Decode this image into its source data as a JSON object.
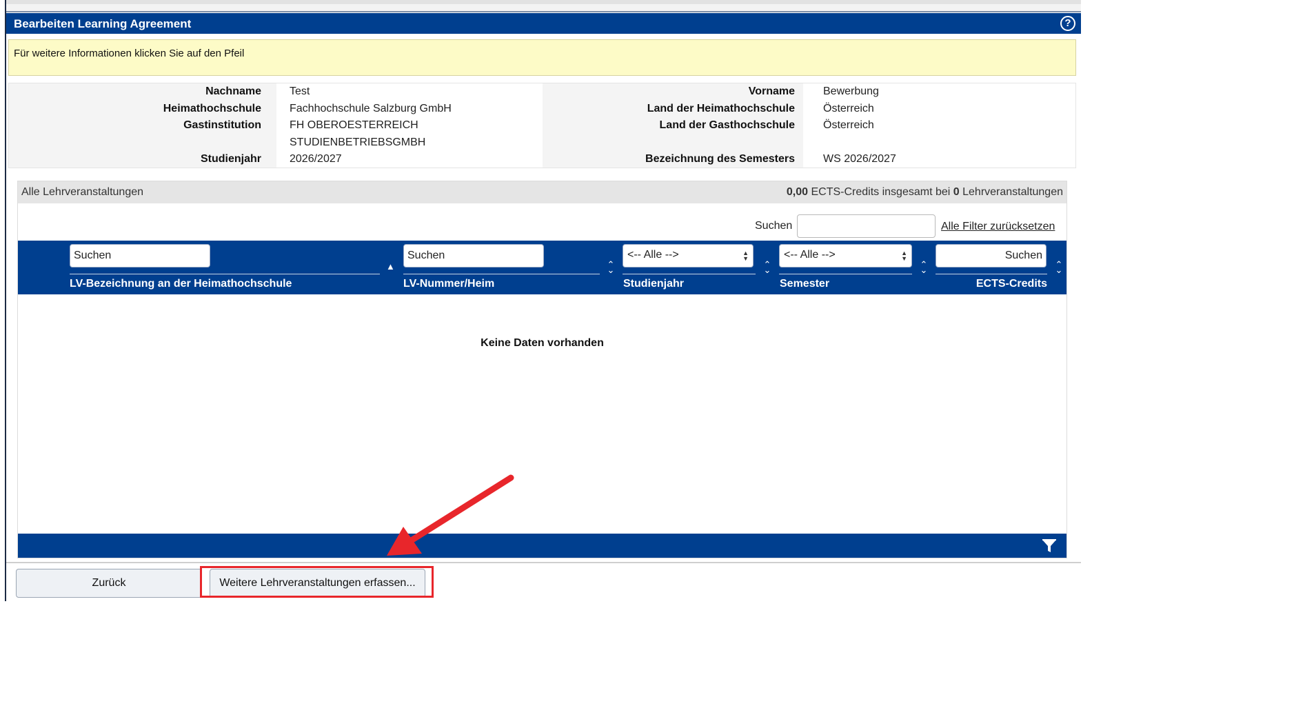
{
  "window": {
    "title": "Bearbeiten Learning Agreement",
    "help_icon": "question-circle-icon"
  },
  "info_box": {
    "text": "Für weitere Informationen klicken Sie auf den Pfeil"
  },
  "student_info": {
    "nachname_label": "Nachname",
    "nachname": "Test",
    "heimathochschule_label": "Heimathochschule",
    "heimathochschule": "Fachhochschule Salzburg GmbH",
    "gastinstitution_label": "Gastinstitution",
    "gastinstitution_line1": "FH OBEROESTERREICH",
    "gastinstitution_line2": "STUDIENBETRIEBSGMBH",
    "studienjahr_label": "Studienjahr",
    "studienjahr": "2026/2027",
    "vorname_label": "Vorname",
    "vorname": "Bewerbung",
    "land_heimat_label": "Land der Heimathochschule",
    "land_heimat": "Österreich",
    "land_gast_label": "Land der Gasthochschule",
    "land_gast": "Österreich",
    "semester_label": "Bezeichnung des Semesters",
    "semester": "WS 2026/2027"
  },
  "courses": {
    "heading": "Alle Lehrveranstaltungen",
    "ects_total": "0,00",
    "summary_mid": " ECTS-Credits insgesamt bei ",
    "course_count": "0",
    "summary_end": " Lehrveranstaltungen",
    "global_search_label": "Suchen",
    "global_search_value": "",
    "reset_filters": "Alle Filter zurücksetzen",
    "columns": [
      {
        "label": "LV-Bezeichnung an der Heimathochschule",
        "filter_placeholder": "Suchen"
      },
      {
        "label": "LV-Nummer/Heim",
        "filter_placeholder": "Suchen"
      },
      {
        "label": "Studienjahr",
        "filter_value": "<-- Alle -->"
      },
      {
        "label": "Semester",
        "filter_value": "<-- Alle -->"
      },
      {
        "label": "ECTS-Credits",
        "filter_placeholder": "Suchen"
      }
    ],
    "empty_message": "Keine Daten vorhanden",
    "footer_icon": "filter-funnel-icon"
  },
  "buttons": {
    "back": "Zurück",
    "add_courses": "Weitere Lehrveranstaltungen erfassen..."
  },
  "annotation": {
    "arrow_color": "#e8262b",
    "highlight_color": "#e8262b"
  }
}
